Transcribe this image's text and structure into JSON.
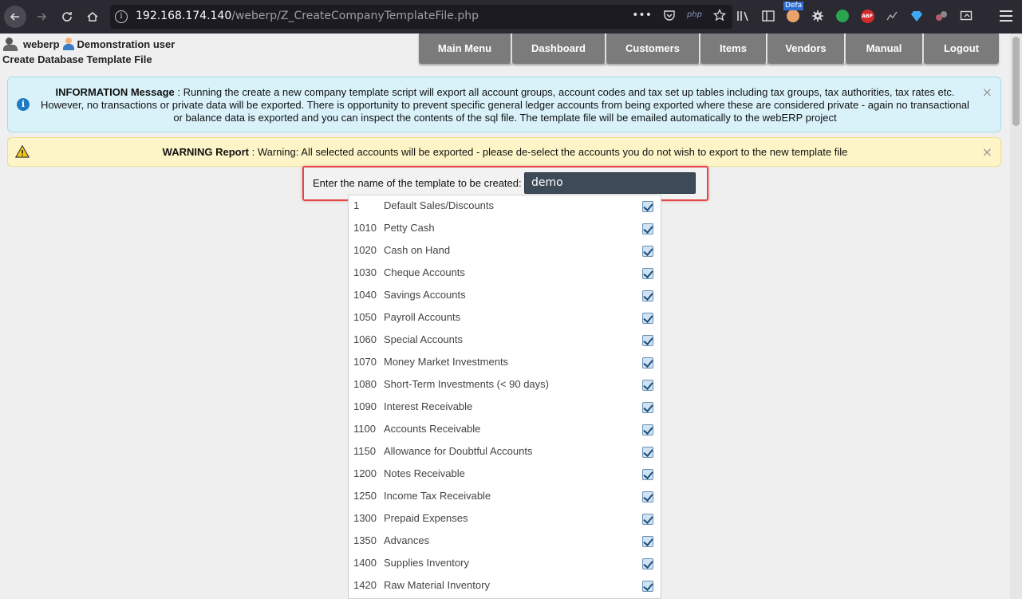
{
  "browser": {
    "url_host": "192.168.174.140",
    "url_path": "/weberp/Z_CreateCompanyTemplateFile.php",
    "toolbar_badge": "Defa",
    "php_label": "php",
    "abp_label": "ABP"
  },
  "header": {
    "app_name": "weberp",
    "user_name": "Demonstration user",
    "page_title": "Create Database Template File"
  },
  "nav": {
    "items": [
      {
        "label": "Main Menu"
      },
      {
        "label": "Dashboard"
      },
      {
        "label": "Customers"
      },
      {
        "label": "Items"
      },
      {
        "label": "Vendors"
      },
      {
        "label": "Manual"
      },
      {
        "label": "Logout"
      }
    ]
  },
  "info_message": {
    "title": "INFORMATION Message",
    "text": " : Running the create a new company template script will export all account groups, account codes and tax set up tables including tax groups, tax authorities, tax rates etc. However, no transactions or private data will be exported. There is opportunity to prevent specific general ledger accounts from being exported where these are considered private - again no transactional or balance data is exported and you can inspect the contents of the sql file. The template file will be emailed automatically to the webERP project"
  },
  "warning_message": {
    "title": "WARNING Report",
    "text": " : Warning: All selected accounts will be exported - please de-select the accounts you do not wish to export to the new template file"
  },
  "close_symbol": "×",
  "template_form": {
    "label": "Enter the name of the template to be created:",
    "value": "demo"
  },
  "accounts": [
    {
      "code": "1",
      "name": "Default Sales/Discounts",
      "checked": true
    },
    {
      "code": "1010",
      "name": "Petty Cash",
      "checked": true
    },
    {
      "code": "1020",
      "name": "Cash on Hand",
      "checked": true
    },
    {
      "code": "1030",
      "name": "Cheque Accounts",
      "checked": true
    },
    {
      "code": "1040",
      "name": "Savings Accounts",
      "checked": true
    },
    {
      "code": "1050",
      "name": "Payroll Accounts",
      "checked": true
    },
    {
      "code": "1060",
      "name": "Special Accounts",
      "checked": true
    },
    {
      "code": "1070",
      "name": "Money Market Investments",
      "checked": true
    },
    {
      "code": "1080",
      "name": "Short-Term Investments (< 90 days)",
      "checked": true
    },
    {
      "code": "1090",
      "name": "Interest Receivable",
      "checked": true
    },
    {
      "code": "1100",
      "name": "Accounts Receivable",
      "checked": true
    },
    {
      "code": "1150",
      "name": "Allowance for Doubtful Accounts",
      "checked": true
    },
    {
      "code": "1200",
      "name": "Notes Receivable",
      "checked": true
    },
    {
      "code": "1250",
      "name": "Income Tax Receivable",
      "checked": true
    },
    {
      "code": "1300",
      "name": "Prepaid Expenses",
      "checked": true
    },
    {
      "code": "1350",
      "name": "Advances",
      "checked": true
    },
    {
      "code": "1400",
      "name": "Supplies Inventory",
      "checked": true
    },
    {
      "code": "1420",
      "name": "Raw Material Inventory",
      "checked": true
    }
  ]
}
